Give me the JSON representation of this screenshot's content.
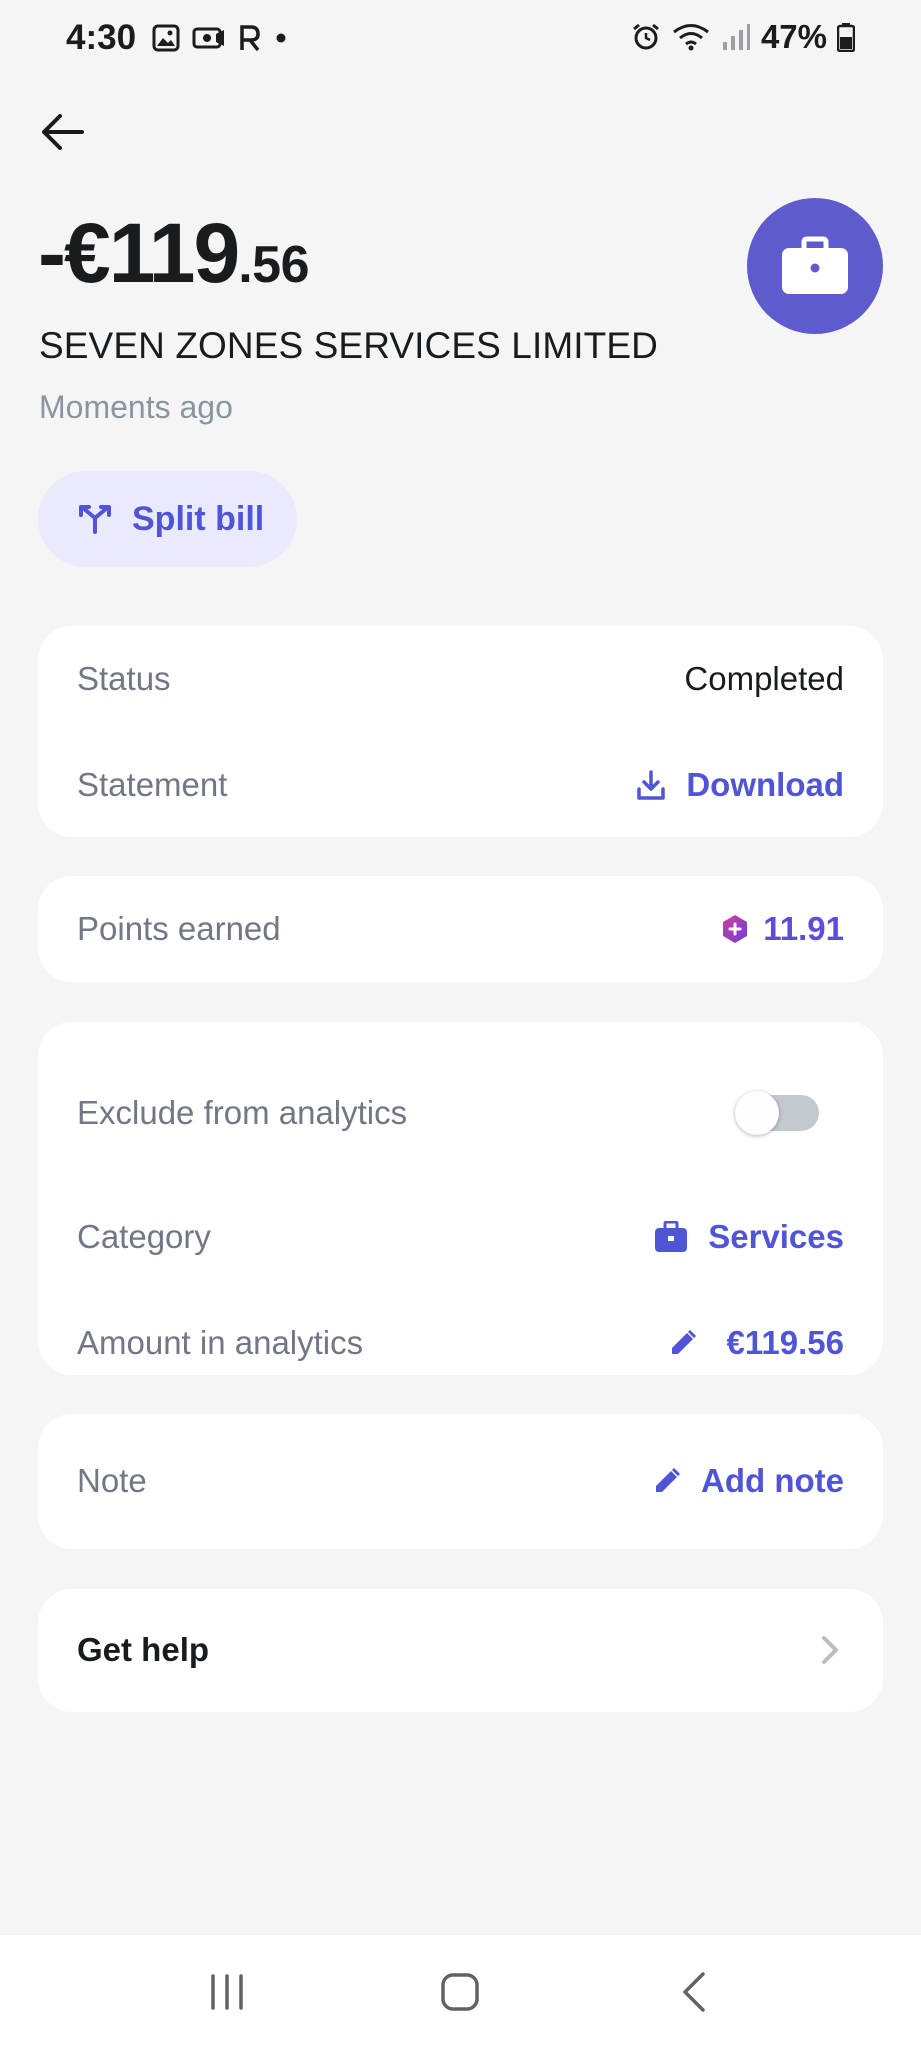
{
  "status_bar": {
    "time": "4:30",
    "battery": "47%",
    "left_icons": [
      "gallery-icon",
      "camera-icon",
      "r-icon",
      "dot-icon"
    ],
    "right_icons": [
      "alarm-icon",
      "wifi-icon",
      "signal-icon",
      "battery-icon"
    ]
  },
  "transaction": {
    "amount_main": "-€119",
    "amount_cents": ".56",
    "merchant": "SEVEN ZONES SERVICES LIMITED",
    "time": "Moments ago",
    "avatar_icon": "briefcase-icon",
    "avatar_color": "#5e5bcf"
  },
  "actions": {
    "split_bill_label": "Split bill"
  },
  "details_card": {
    "status_label": "Status",
    "status_value": "Completed",
    "statement_label": "Statement",
    "statement_value": "Download"
  },
  "points_card": {
    "label": "Points earned",
    "value": "11.91"
  },
  "analytics_card": {
    "exclude_label": "Exclude from analytics",
    "exclude_toggle_on": false,
    "category_label": "Category",
    "category_value": "Services",
    "amount_label": "Amount in analytics",
    "amount_value": "€119.56"
  },
  "note_card": {
    "label": "Note",
    "action": "Add note"
  },
  "help_card": {
    "label": "Get help"
  },
  "colors": {
    "accent": "#4f55d6",
    "background": "#f5f5f6",
    "card": "#ffffff",
    "muted_text": "#717785"
  },
  "nav_bar": {
    "icons": [
      "recent-apps-icon",
      "home-icon",
      "back-nav-icon"
    ]
  }
}
